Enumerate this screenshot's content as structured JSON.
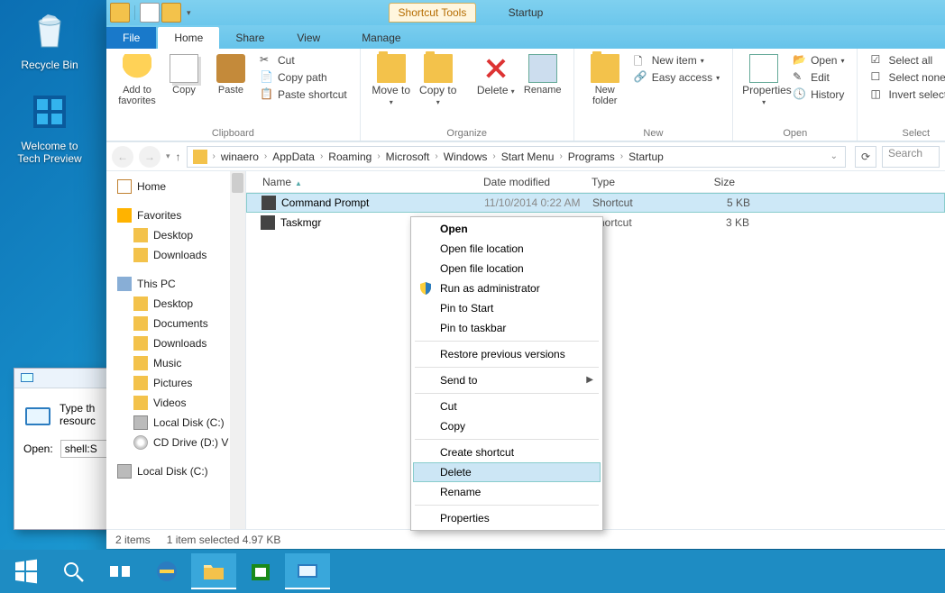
{
  "desktop": {
    "recyclebin": "Recycle Bin",
    "techpreview": "Welcome to Tech Preview"
  },
  "run": {
    "text": "Type th",
    "text2": "resourc",
    "openlabel": "Open:",
    "value": "shell:S"
  },
  "explorer": {
    "tooltab": "Shortcut Tools",
    "title": "Startup",
    "tabs": {
      "file": "File",
      "home": "Home",
      "share": "Share",
      "view": "View",
      "manage": "Manage"
    },
    "ribbon": {
      "pinfav": "Add to favorites",
      "copy": "Copy",
      "paste": "Paste",
      "cut": "Cut",
      "copypath": "Copy path",
      "pasteshortcut": "Paste shortcut",
      "clipboard": "Clipboard",
      "moveto": "Move to",
      "copyto": "Copy to",
      "delete": "Delete",
      "rename": "Rename",
      "organize": "Organize",
      "newfolder": "New folder",
      "newitem": "New item",
      "easyaccess": "Easy access",
      "new": "New",
      "properties": "Properties",
      "open": "Open",
      "edit": "Edit",
      "history": "History",
      "opengroup": "Open",
      "selectall": "Select all",
      "selectnone": "Select none",
      "invert": "Invert selection",
      "select": "Select"
    },
    "breadcrumbs": [
      "winaero",
      "AppData",
      "Roaming",
      "Microsoft",
      "Windows",
      "Start Menu",
      "Programs",
      "Startup"
    ],
    "search": "Search",
    "columns": {
      "name": "Name",
      "date": "Date modified",
      "type": "Type",
      "size": "Size"
    },
    "sidebar": {
      "home": "Home",
      "favorites": "Favorites",
      "desktop": "Desktop",
      "downloads": "Downloads",
      "thispc": "This PC",
      "documents": "Documents",
      "music": "Music",
      "pictures": "Pictures",
      "videos": "Videos",
      "localdiskc": "Local Disk (C:)",
      "cddrive": "CD Drive (D:) V",
      "localdiskc2": "Local Disk (C:)"
    },
    "files": [
      {
        "name": "Command Prompt",
        "date": "11/10/2014 0:22 AM",
        "type": "Shortcut",
        "size": "5 KB"
      },
      {
        "name": "Taskmgr",
        "date": "",
        "type": "Shortcut",
        "size": "3 KB"
      }
    ],
    "status": {
      "items": "2 items",
      "selected": "1 item selected  4.97 KB"
    }
  },
  "context": {
    "open": "Open",
    "openloc1": "Open file location",
    "openloc2": "Open file location",
    "runadmin": "Run as administrator",
    "pinstart": "Pin to Start",
    "pintaskbar": "Pin to taskbar",
    "restore": "Restore previous versions",
    "sendto": "Send to",
    "cut": "Cut",
    "copy": "Copy",
    "createshortcut": "Create shortcut",
    "delete": "Delete",
    "rename": "Rename",
    "properties": "Properties"
  }
}
